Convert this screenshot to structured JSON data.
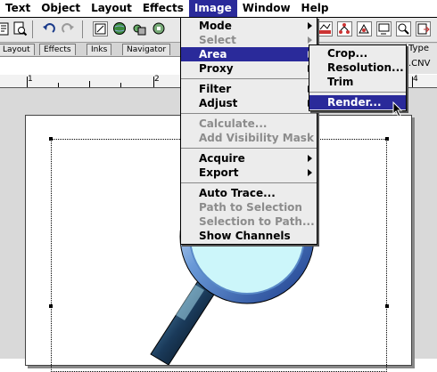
{
  "menubar": {
    "items": [
      "Text",
      "Object",
      "Layout",
      "Effects",
      "Image",
      "Window",
      "Help"
    ],
    "active": "Image"
  },
  "toolbar": {
    "icons": [
      "print-icon",
      "print-preview-icon",
      "undo-icon",
      "redo-icon",
      "transform-icon",
      "globe-icon",
      "arrange-icon",
      "plugin-icon"
    ]
  },
  "palette_tabs": [
    "Layout",
    "Effects",
    "Inks",
    "Navigator"
  ],
  "right_strip": {
    "tab": "Type",
    "filename": ".CNV"
  },
  "ruler": {
    "numbers": [
      "1",
      "2",
      "4"
    ]
  },
  "image_menu": {
    "items": [
      {
        "label": "Mode",
        "submenu": true,
        "enabled": true
      },
      {
        "label": "Select",
        "submenu": true,
        "enabled": false
      },
      {
        "label": "Area",
        "submenu": true,
        "enabled": true,
        "highlighted": true
      },
      {
        "label": "Proxy",
        "submenu": true,
        "enabled": true
      },
      {
        "label": "Filter",
        "submenu": true,
        "enabled": true
      },
      {
        "label": "Adjust",
        "submenu": true,
        "enabled": true
      },
      {
        "label": "Calculate...",
        "submenu": false,
        "enabled": false
      },
      {
        "label": "Add Visibility Mask",
        "submenu": false,
        "enabled": false
      },
      {
        "label": "Acquire",
        "submenu": true,
        "enabled": true
      },
      {
        "label": "Export",
        "submenu": true,
        "enabled": true
      },
      {
        "label": "Auto Trace...",
        "submenu": false,
        "enabled": true
      },
      {
        "label": "Path to Selection",
        "submenu": false,
        "enabled": false
      },
      {
        "label": "Selection to Path...",
        "submenu": false,
        "enabled": false
      },
      {
        "label": "Show Channels",
        "submenu": false,
        "enabled": true
      }
    ]
  },
  "area_submenu": {
    "items": [
      {
        "label": "Crop...",
        "highlighted": false
      },
      {
        "label": "Resolution...",
        "highlighted": false
      },
      {
        "label": "Trim",
        "highlighted": false
      },
      {
        "label": "Render...",
        "highlighted": true
      }
    ]
  },
  "colors": {
    "highlight": "#2a2a9a",
    "menu_bg": "#ececec",
    "lens_fill": "#ccf6fa",
    "lens_rim": "#3a6ab0"
  }
}
